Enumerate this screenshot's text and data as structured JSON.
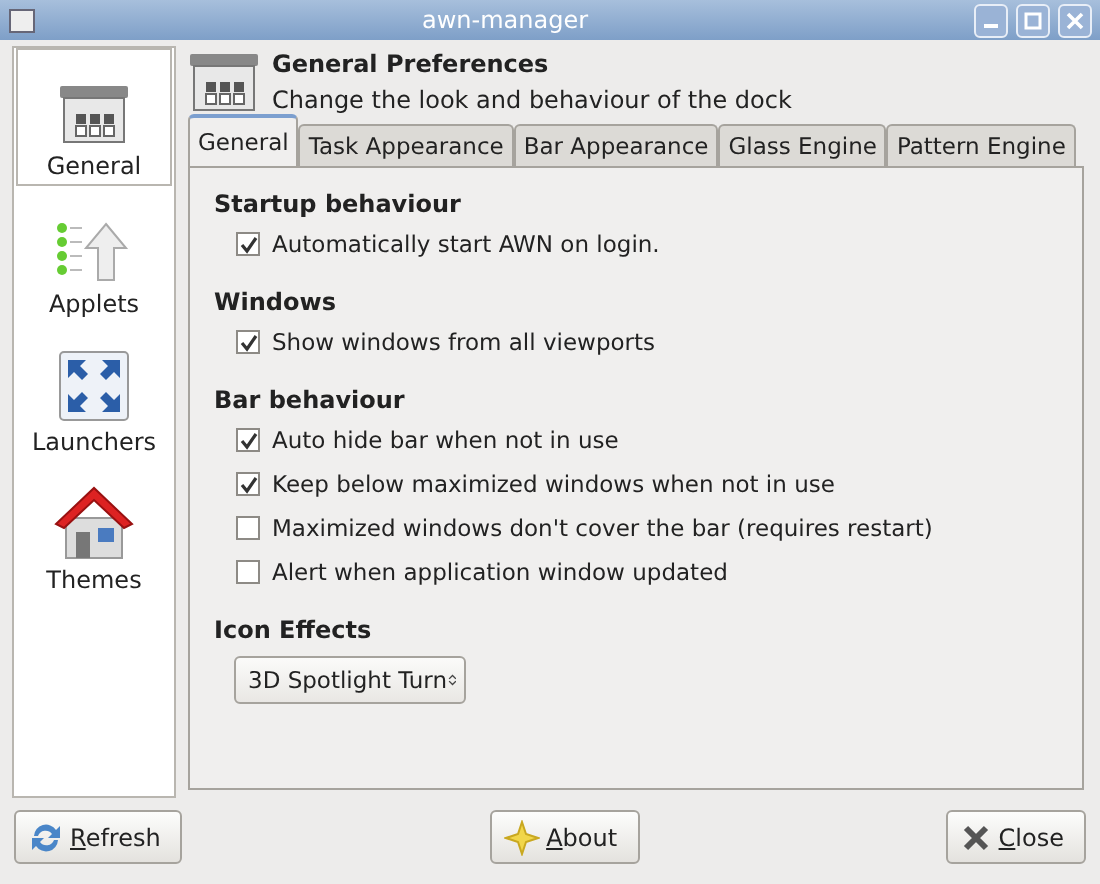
{
  "window": {
    "title": "awn-manager"
  },
  "sidebar": {
    "items": [
      {
        "label": "General",
        "kind": "general",
        "selected": true
      },
      {
        "label": "Applets",
        "kind": "applets",
        "selected": false
      },
      {
        "label": "Launchers",
        "kind": "launchers",
        "selected": false
      },
      {
        "label": "Themes",
        "kind": "themes",
        "selected": false
      }
    ]
  },
  "header": {
    "title": "General Preferences",
    "subtitle": "Change the look and behaviour of the dock"
  },
  "tabs": [
    {
      "label": "General",
      "selected": true
    },
    {
      "label": "Task Appearance",
      "selected": false
    },
    {
      "label": "Bar Appearance",
      "selected": false
    },
    {
      "label": "Glass Engine",
      "selected": false
    },
    {
      "label": "Pattern Engine",
      "selected": false
    }
  ],
  "sections": [
    {
      "title": "Startup behaviour",
      "options": [
        {
          "label": "Automatically start AWN on login.",
          "checked": true
        }
      ]
    },
    {
      "title": "Windows",
      "options": [
        {
          "label": "Show windows from all viewports",
          "checked": true
        }
      ]
    },
    {
      "title": "Bar behaviour",
      "options": [
        {
          "label": "Auto hide bar when not in use",
          "checked": true
        },
        {
          "label": "Keep below maximized windows when not in use",
          "checked": true
        },
        {
          "label": "Maximized windows don't cover the bar (requires restart)",
          "checked": false
        },
        {
          "label": "Alert when application window updated",
          "checked": false
        }
      ]
    }
  ],
  "icon_effects": {
    "title": "Icon Effects",
    "value": "3D Spotlight Turn"
  },
  "buttons": [
    {
      "label": "Refresh",
      "kind": "refresh"
    },
    {
      "label": "About",
      "kind": "about"
    },
    {
      "label": "Close",
      "kind": "close"
    }
  ]
}
